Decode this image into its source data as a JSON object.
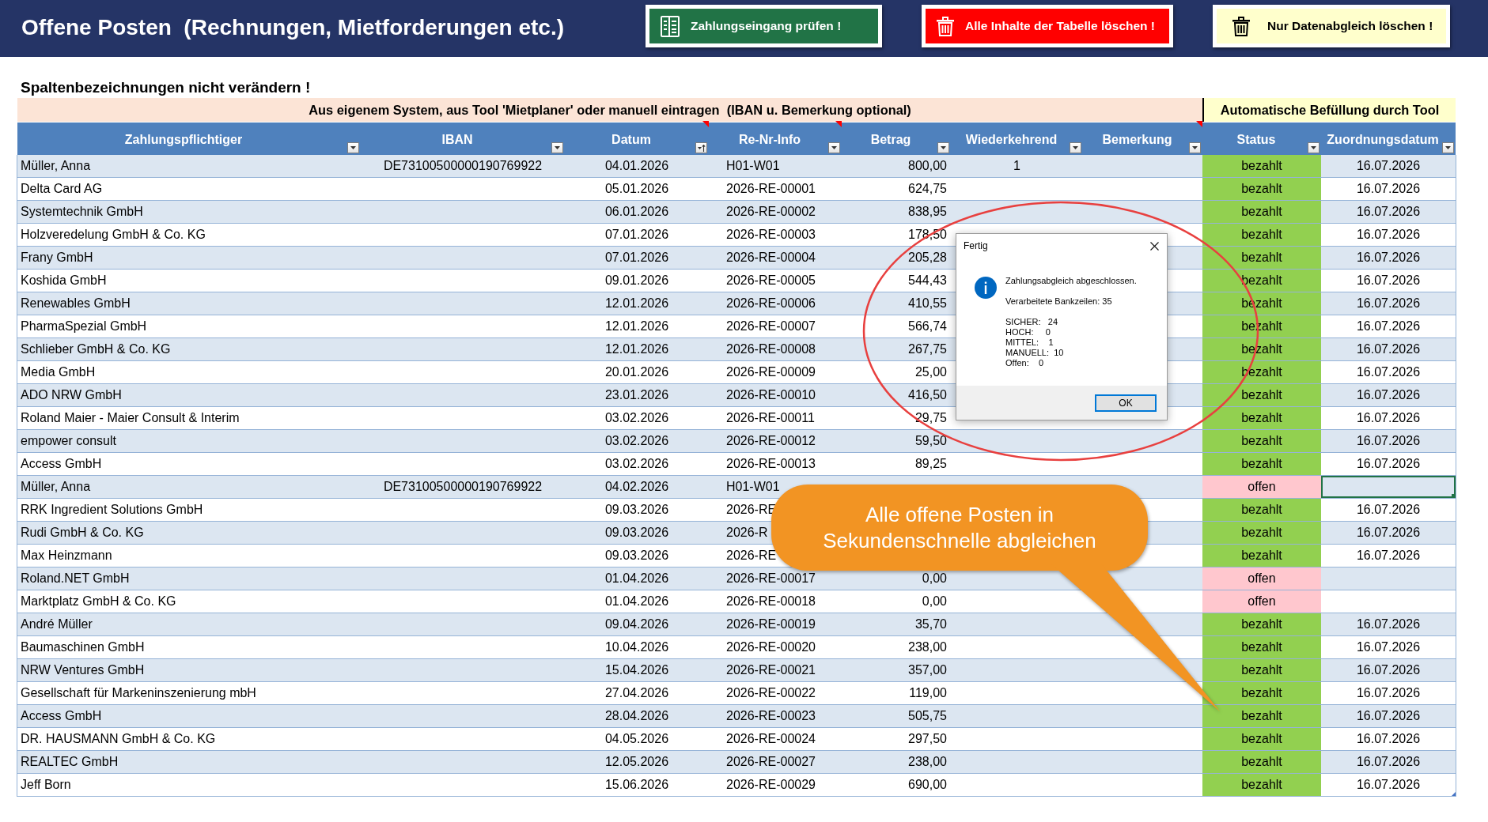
{
  "header": {
    "title": "Offene Posten  (Rechnungen, Mietforderungen etc.)",
    "buttons": [
      {
        "kind": "check_payments",
        "label": "Zahlungseingang prüfen !"
      },
      {
        "kind": "clear_all",
        "label": "Alle Inhalte der Tabelle löschen !"
      },
      {
        "kind": "clear_matching",
        "label": "Nur Datenabgleich löschen !"
      }
    ]
  },
  "note": "Spaltenbezeichnungen nicht verändern !",
  "table": {
    "group_headers": [
      {
        "kind": "manual",
        "label": "Aus eigenem System, aus Tool 'Mietplaner' oder manuell eintragen  (IBAN u. Bemerkung optional)"
      },
      {
        "kind": "tool",
        "label": "Automatische Befüllung durch Tool"
      }
    ],
    "columns": [
      {
        "label": "Zahlungspflichtiger",
        "comment": false,
        "sorted": false
      },
      {
        "label": "IBAN",
        "comment": false,
        "sorted": false
      },
      {
        "label": "Datum",
        "comment": true,
        "sorted": true
      },
      {
        "label": "Re-Nr-Info",
        "comment": true,
        "sorted": false
      },
      {
        "label": "Betrag",
        "comment": false,
        "sorted": false
      },
      {
        "label": "Wiederkehrend",
        "comment": false,
        "sorted": false
      },
      {
        "label": "Bemerkung",
        "comment": true,
        "sorted": false
      },
      {
        "label": "Status",
        "comment": false,
        "sorted": false
      },
      {
        "label": "Zuordnungsdatum",
        "comment": false,
        "sorted": false
      }
    ],
    "rows": [
      {
        "payer": "Müller, Anna",
        "iban": "DE73100500000190769922",
        "date": "04.01.2026",
        "invoice": "H01-W01",
        "amount": "800,00",
        "recurring": "1",
        "status": "bezahlt",
        "color": "#92d050",
        "assigned_on": "16.07.2026",
        "selected": false
      },
      {
        "payer": "Delta Card AG",
        "date": "05.01.2026",
        "invoice": "2026-RE-00001",
        "amount": "624,75",
        "status": "bezahlt",
        "color": "#92d050",
        "assigned_on": "16.07.2026",
        "selected": false
      },
      {
        "payer": "Systemtechnik GmbH",
        "date": "06.01.2026",
        "invoice": "2026-RE-00002",
        "amount": "838,95",
        "status": "bezahlt",
        "color": "#92d050",
        "assigned_on": "16.07.2026",
        "selected": false
      },
      {
        "payer": "Holzveredelung GmbH & Co. KG",
        "date": "07.01.2026",
        "invoice": "2026-RE-00003",
        "amount": "178,50",
        "status": "bezahlt",
        "color": "#92d050",
        "assigned_on": "16.07.2026",
        "selected": false
      },
      {
        "payer": "Frany GmbH",
        "date": "07.01.2026",
        "invoice": "2026-RE-00004",
        "amount": "205,28",
        "status": "bezahlt",
        "color": "#92d050",
        "assigned_on": "16.07.2026",
        "selected": false
      },
      {
        "payer": "Koshida GmbH",
        "date": "09.01.2026",
        "invoice": "2026-RE-00005",
        "amount": "544,43",
        "status": "bezahlt",
        "color": "#92d050",
        "assigned_on": "16.07.2026",
        "selected": false
      },
      {
        "payer": "Renewables GmbH",
        "date": "12.01.2026",
        "invoice": "2026-RE-00006",
        "amount": "410,55",
        "status": "bezahlt",
        "color": "#92d050",
        "assigned_on": "16.07.2026",
        "selected": false
      },
      {
        "payer": "PharmaSpezial GmbH",
        "date": "12.01.2026",
        "invoice": "2026-RE-00007",
        "amount": "566,74",
        "status": "bezahlt",
        "color": "#92d050",
        "assigned_on": "16.07.2026",
        "selected": false
      },
      {
        "payer": "Schlieber GmbH & Co. KG",
        "date": "12.01.2026",
        "invoice": "2026-RE-00008",
        "amount": "267,75",
        "status": "bezahlt",
        "color": "#92d050",
        "assigned_on": "16.07.2026",
        "selected": false
      },
      {
        "payer": "Media GmbH",
        "date": "20.01.2026",
        "invoice": "2026-RE-00009",
        "amount": "25,00",
        "status": "bezahlt",
        "color": "#92d050",
        "assigned_on": "16.07.2026",
        "selected": false
      },
      {
        "payer": "ADO NRW GmbH",
        "date": "23.01.2026",
        "invoice": "2026-RE-00010",
        "amount": "416,50",
        "status": "bezahlt",
        "color": "#92d050",
        "assigned_on": "16.07.2026",
        "selected": false
      },
      {
        "payer": "Roland Maier - Maier Consult & Interim",
        "date": "03.02.2026",
        "invoice": "2026-RE-00011",
        "amount": "29,75",
        "status": "bezahlt",
        "color": "#92d050",
        "assigned_on": "16.07.2026",
        "selected": false
      },
      {
        "payer": "empower consult",
        "date": "03.02.2026",
        "invoice": "2026-RE-00012",
        "amount": "59,50",
        "status": "bezahlt",
        "color": "#92d050",
        "assigned_on": "16.07.2026",
        "selected": false
      },
      {
        "payer": "Access GmbH",
        "date": "03.02.2026",
        "invoice": "2026-RE-00013",
        "amount": "89,25",
        "status": "bezahlt",
        "color": "#92d050",
        "assigned_on": "16.07.2026",
        "selected": false
      },
      {
        "payer": "Müller, Anna",
        "iban": "DE73100500000190769922",
        "date": "04.02.2026",
        "invoice": "H01-W01",
        "status": "offen",
        "color": "#ffc7ce",
        "selected": true
      },
      {
        "payer": "RRK Ingredient Solutions GmbH",
        "date": "09.03.2026",
        "invoice": "2026-RE",
        "status": "bezahlt",
        "color": "#92d050",
        "assigned_on": "16.07.2026",
        "selected": false
      },
      {
        "payer": "Rudi GmbH & Co. KG",
        "date": "09.03.2026",
        "invoice": "2026-R",
        "status": "bezahlt",
        "color": "#92d050",
        "assigned_on": "16.07.2026",
        "selected": false
      },
      {
        "payer": "Max Heinzmann",
        "date": "09.03.2026",
        "invoice": "2026-RE",
        "status": "bezahlt",
        "color": "#92d050",
        "assigned_on": "16.07.2026",
        "selected": false
      },
      {
        "payer": "Roland.NET GmbH",
        "date": "01.04.2026",
        "invoice": "2026-RE-00017",
        "amount": "0,00",
        "status": "offen",
        "color": "#ffc7ce",
        "selected": false
      },
      {
        "payer": "Marktplatz GmbH & Co. KG",
        "date": "01.04.2026",
        "invoice": "2026-RE-00018",
        "amount": "0,00",
        "status": "offen",
        "color": "#ffc7ce",
        "selected": false
      },
      {
        "payer": "André Müller",
        "date": "09.04.2026",
        "invoice": "2026-RE-00019",
        "amount": "35,70",
        "status": "bezahlt",
        "color": "#92d050",
        "assigned_on": "16.07.2026",
        "selected": false
      },
      {
        "payer": "Baumaschinen GmbH",
        "date": "10.04.2026",
        "invoice": "2026-RE-00020",
        "amount": "238,00",
        "status": "bezahlt",
        "color": "#92d050",
        "assigned_on": "16.07.2026",
        "selected": false
      },
      {
        "payer": "NRW Ventures GmbH",
        "date": "15.04.2026",
        "invoice": "2026-RE-00021",
        "amount": "357,00",
        "status": "bezahlt",
        "color": "#92d050",
        "assigned_on": "16.07.2026",
        "selected": false
      },
      {
        "payer": "Gesellschaft für Markeninszenierung mbH",
        "date": "27.04.2026",
        "invoice": "2026-RE-00022",
        "amount": "119,00",
        "status": "bezahlt",
        "color": "#92d050",
        "assigned_on": "16.07.2026",
        "selected": false
      },
      {
        "payer": "Access GmbH",
        "date": "28.04.2026",
        "invoice": "2026-RE-00023",
        "amount": "505,75",
        "status": "bezahlt",
        "color": "#92d050",
        "assigned_on": "16.07.2026",
        "selected": false
      },
      {
        "payer": "DR. HAUSMANN GmbH & Co. KG",
        "date": "04.05.2026",
        "invoice": "2026-RE-00024",
        "amount": "297,50",
        "status": "bezahlt",
        "color": "#92d050",
        "assigned_on": "16.07.2026",
        "selected": false
      },
      {
        "payer": "REALTEC GmbH",
        "date": "12.05.2026",
        "invoice": "2026-RE-00027",
        "amount": "238,00",
        "status": "bezahlt",
        "color": "#92d050",
        "assigned_on": "16.07.2026",
        "selected": false
      },
      {
        "payer": "Jeff Born",
        "date": "15.06.2026",
        "invoice": "2026-RE-00029",
        "amount": "690,00",
        "status": "bezahlt",
        "color": "#92d050",
        "assigned_on": "16.07.2026",
        "selected": false
      }
    ]
  },
  "dialog": {
    "title": "Fertig",
    "lines": [
      "Zahlungsabgleich abgeschlossen.",
      "Verarbeitete Bankzeilen: 35"
    ],
    "counts": [
      "SICHER:   24",
      "HOCH:     0",
      "MITTEL:    1",
      "MANUELL:  10",
      "Offen:    0"
    ],
    "button": "OK"
  },
  "callout": {
    "text": "Alle offene Posten in Sekundenschnelle abgleichen"
  }
}
